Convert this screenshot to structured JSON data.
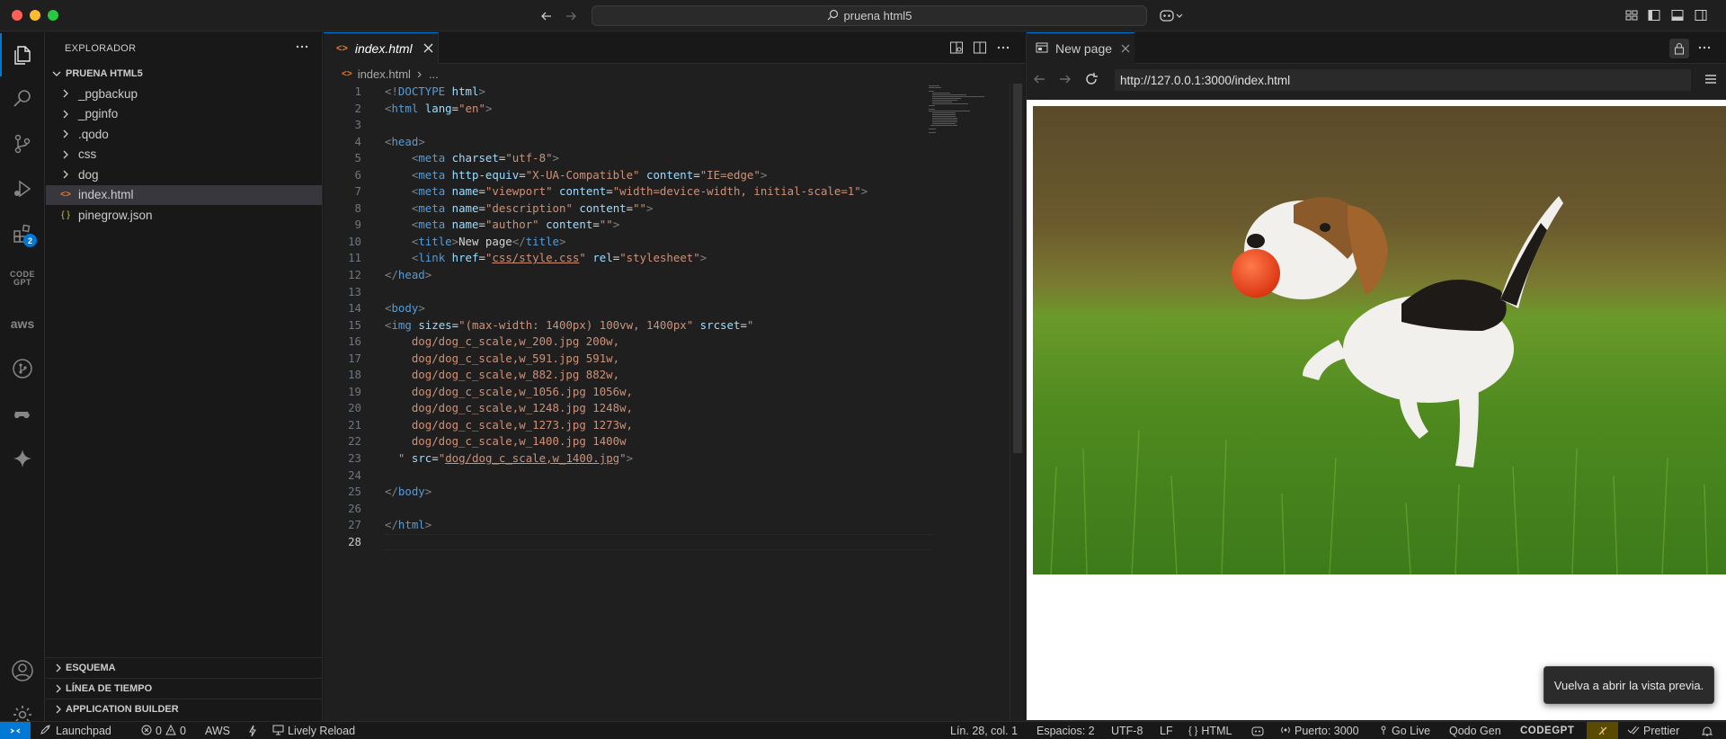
{
  "titlebar": {
    "search_text": "pruena html5"
  },
  "activity_bar": {
    "extensions_badge": "2",
    "codegpt_label": "CODE\nGPT",
    "aws_label": "aws"
  },
  "explorer": {
    "header": "EXPLORADOR",
    "project_name": "PRUENA HTML5",
    "items": [
      {
        "label": "_pgbackup",
        "type": "folder"
      },
      {
        "label": "_pginfo",
        "type": "folder"
      },
      {
        "label": ".qodo",
        "type": "folder"
      },
      {
        "label": "css",
        "type": "folder"
      },
      {
        "label": "dog",
        "type": "folder"
      },
      {
        "label": "index.html",
        "type": "file",
        "selected": true
      },
      {
        "label": "pinegrow.json",
        "type": "json"
      }
    ],
    "bottom_sections": [
      "ESQUEMA",
      "LÍNEA DE TIEMPO",
      "APPLICATION BUILDER"
    ]
  },
  "editor": {
    "tab_label": "index.html",
    "breadcrumb_file": "index.html",
    "breadcrumb_more": "...",
    "current_line": 28,
    "lines": [
      [
        {
          "c": "pun",
          "t": "<!"
        },
        {
          "c": "tag",
          "t": "DOCTYPE"
        },
        {
          "c": "txt",
          "t": " "
        },
        {
          "c": "attr",
          "t": "html"
        },
        {
          "c": "pun",
          "t": ">"
        }
      ],
      [
        {
          "c": "pun",
          "t": "<"
        },
        {
          "c": "tag",
          "t": "html"
        },
        {
          "c": "txt",
          "t": " "
        },
        {
          "c": "attr",
          "t": "lang"
        },
        {
          "c": "txt",
          "t": "="
        },
        {
          "c": "str",
          "t": "\"en\""
        },
        {
          "c": "pun",
          "t": ">"
        }
      ],
      [],
      [
        {
          "c": "pun",
          "t": "<"
        },
        {
          "c": "tag",
          "t": "head"
        },
        {
          "c": "pun",
          "t": ">"
        }
      ],
      [
        {
          "c": "txt",
          "t": "    "
        },
        {
          "c": "pun",
          "t": "<"
        },
        {
          "c": "tag",
          "t": "meta"
        },
        {
          "c": "txt",
          "t": " "
        },
        {
          "c": "attr",
          "t": "charset"
        },
        {
          "c": "txt",
          "t": "="
        },
        {
          "c": "str",
          "t": "\"utf-8\""
        },
        {
          "c": "pun",
          "t": ">"
        }
      ],
      [
        {
          "c": "txt",
          "t": "    "
        },
        {
          "c": "pun",
          "t": "<"
        },
        {
          "c": "tag",
          "t": "meta"
        },
        {
          "c": "txt",
          "t": " "
        },
        {
          "c": "attr",
          "t": "http-equiv"
        },
        {
          "c": "txt",
          "t": "="
        },
        {
          "c": "str",
          "t": "\"X-UA-Compatible\""
        },
        {
          "c": "txt",
          "t": " "
        },
        {
          "c": "attr",
          "t": "content"
        },
        {
          "c": "txt",
          "t": "="
        },
        {
          "c": "str",
          "t": "\"IE=edge\""
        },
        {
          "c": "pun",
          "t": ">"
        }
      ],
      [
        {
          "c": "txt",
          "t": "    "
        },
        {
          "c": "pun",
          "t": "<"
        },
        {
          "c": "tag",
          "t": "meta"
        },
        {
          "c": "txt",
          "t": " "
        },
        {
          "c": "attr",
          "t": "name"
        },
        {
          "c": "txt",
          "t": "="
        },
        {
          "c": "str",
          "t": "\"viewport\""
        },
        {
          "c": "txt",
          "t": " "
        },
        {
          "c": "attr",
          "t": "content"
        },
        {
          "c": "txt",
          "t": "="
        },
        {
          "c": "str",
          "t": "\"width=device-width, initial-scale=1\""
        },
        {
          "c": "pun",
          "t": ">"
        }
      ],
      [
        {
          "c": "txt",
          "t": "    "
        },
        {
          "c": "pun",
          "t": "<"
        },
        {
          "c": "tag",
          "t": "meta"
        },
        {
          "c": "txt",
          "t": " "
        },
        {
          "c": "attr",
          "t": "name"
        },
        {
          "c": "txt",
          "t": "="
        },
        {
          "c": "str",
          "t": "\"description\""
        },
        {
          "c": "txt",
          "t": " "
        },
        {
          "c": "attr",
          "t": "content"
        },
        {
          "c": "txt",
          "t": "="
        },
        {
          "c": "str",
          "t": "\"\""
        },
        {
          "c": "pun",
          "t": ">"
        }
      ],
      [
        {
          "c": "txt",
          "t": "    "
        },
        {
          "c": "pun",
          "t": "<"
        },
        {
          "c": "tag",
          "t": "meta"
        },
        {
          "c": "txt",
          "t": " "
        },
        {
          "c": "attr",
          "t": "name"
        },
        {
          "c": "txt",
          "t": "="
        },
        {
          "c": "str",
          "t": "\"author\""
        },
        {
          "c": "txt",
          "t": " "
        },
        {
          "c": "attr",
          "t": "content"
        },
        {
          "c": "txt",
          "t": "="
        },
        {
          "c": "str",
          "t": "\"\""
        },
        {
          "c": "pun",
          "t": ">"
        }
      ],
      [
        {
          "c": "txt",
          "t": "    "
        },
        {
          "c": "pun",
          "t": "<"
        },
        {
          "c": "tag",
          "t": "title"
        },
        {
          "c": "pun",
          "t": ">"
        },
        {
          "c": "txt",
          "t": "New page"
        },
        {
          "c": "pun",
          "t": "</"
        },
        {
          "c": "tag",
          "t": "title"
        },
        {
          "c": "pun",
          "t": ">"
        }
      ],
      [
        {
          "c": "txt",
          "t": "    "
        },
        {
          "c": "pun",
          "t": "<"
        },
        {
          "c": "tag",
          "t": "link"
        },
        {
          "c": "txt",
          "t": " "
        },
        {
          "c": "attr",
          "t": "href"
        },
        {
          "c": "txt",
          "t": "="
        },
        {
          "c": "str",
          "t": "\""
        },
        {
          "c": "stru",
          "t": "css/style.css"
        },
        {
          "c": "str",
          "t": "\""
        },
        {
          "c": "txt",
          "t": " "
        },
        {
          "c": "attr",
          "t": "rel"
        },
        {
          "c": "txt",
          "t": "="
        },
        {
          "c": "str",
          "t": "\"stylesheet\""
        },
        {
          "c": "pun",
          "t": ">"
        }
      ],
      [
        {
          "c": "pun",
          "t": "</"
        },
        {
          "c": "tag",
          "t": "head"
        },
        {
          "c": "pun",
          "t": ">"
        }
      ],
      [],
      [
        {
          "c": "pun",
          "t": "<"
        },
        {
          "c": "tag",
          "t": "body"
        },
        {
          "c": "pun",
          "t": ">"
        }
      ],
      [
        {
          "c": "pun",
          "t": "<"
        },
        {
          "c": "tag",
          "t": "img"
        },
        {
          "c": "txt",
          "t": " "
        },
        {
          "c": "attr",
          "t": "sizes"
        },
        {
          "c": "txt",
          "t": "="
        },
        {
          "c": "str",
          "t": "\"(max-width: 1400px) 100vw, 1400px\""
        },
        {
          "c": "txt",
          "t": " "
        },
        {
          "c": "attr",
          "t": "srcset"
        },
        {
          "c": "txt",
          "t": "="
        },
        {
          "c": "str",
          "t": "\""
        }
      ],
      [
        {
          "c": "str",
          "t": "    dog/dog_c_scale,w_200.jpg 200w,"
        }
      ],
      [
        {
          "c": "str",
          "t": "    dog/dog_c_scale,w_591.jpg 591w,"
        }
      ],
      [
        {
          "c": "str",
          "t": "    dog/dog_c_scale,w_882.jpg 882w,"
        }
      ],
      [
        {
          "c": "str",
          "t": "    dog/dog_c_scale,w_1056.jpg 1056w,"
        }
      ],
      [
        {
          "c": "str",
          "t": "    dog/dog_c_scale,w_1248.jpg 1248w,"
        }
      ],
      [
        {
          "c": "str",
          "t": "    dog/dog_c_scale,w_1273.jpg 1273w,"
        }
      ],
      [
        {
          "c": "str",
          "t": "    dog/dog_c_scale,w_1400.jpg 1400w"
        }
      ],
      [
        {
          "c": "str",
          "t": "  \""
        },
        {
          "c": "txt",
          "t": " "
        },
        {
          "c": "attr",
          "t": "src"
        },
        {
          "c": "txt",
          "t": "="
        },
        {
          "c": "str",
          "t": "\""
        },
        {
          "c": "stru",
          "t": "dog/dog_c_scale,w_1400.jpg"
        },
        {
          "c": "str",
          "t": "\""
        },
        {
          "c": "pun",
          "t": ">"
        }
      ],
      [],
      [
        {
          "c": "pun",
          "t": "</"
        },
        {
          "c": "tag",
          "t": "body"
        },
        {
          "c": "pun",
          "t": ">"
        }
      ],
      [],
      [
        {
          "c": "pun",
          "t": "</"
        },
        {
          "c": "tag",
          "t": "html"
        },
        {
          "c": "pun",
          "t": ">"
        }
      ],
      []
    ]
  },
  "browser": {
    "tab_label": "New page",
    "url": "http://127.0.0.1:3000/index.html",
    "toast": "Vuelva a abrir la vista previa."
  },
  "statusbar": {
    "launchpad": "Launchpad",
    "errors": "0",
    "warnings": "0",
    "aws": "AWS",
    "lively_reload": "Lively Reload",
    "position": "Lín. 28, col. 1",
    "spaces": "Espacios: 2",
    "encoding": "UTF-8",
    "eol": "LF",
    "language": "HTML",
    "port": "Puerto: 3000",
    "go_live": "Go Live",
    "qodo": "Qodo Gen",
    "codegpt": "CODEGPT",
    "prettier": "Prettier"
  },
  "colors": {
    "accent": "#0078d4",
    "background": "#1f1f1f",
    "sidebar": "#181818"
  }
}
